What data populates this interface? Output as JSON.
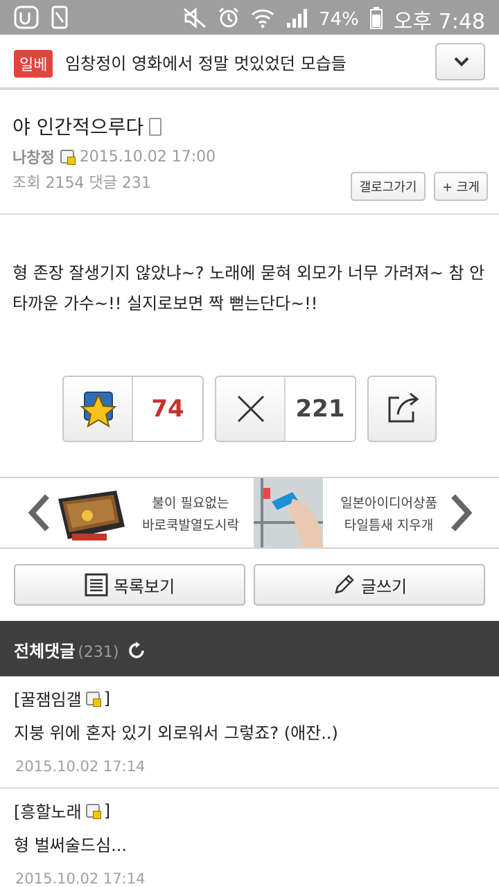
{
  "status_bar": {
    "battery": "74%",
    "time": "오후 7:48"
  },
  "header": {
    "badge": "일베",
    "title": "임창정이 영화에서 정말 멋있었던 모습들"
  },
  "post": {
    "title": "야 인간적으루다",
    "author": "나창정",
    "date": "2015.10.02 17:00",
    "stats": "조회 2154 댓글 231",
    "gallery_btn": "갤로그가기",
    "bigger_btn": "+ 크게",
    "body": "형 존장 잘생기지 않았냐~? 노래에 묻혀 외모가 너무 가려져~ 참 안타까운 가수~!! 실지로보면 짝 뻗는단다~!!"
  },
  "votes": {
    "up_count": "74",
    "down_count": "221"
  },
  "ads": [
    {
      "line1": "불이 필요없는",
      "line2": "바로쿡발열도시락"
    },
    {
      "line1": "일본아이디어상품",
      "line2": "타일틈새 지우개"
    }
  ],
  "actions": {
    "list": "목록보기",
    "write": "글쓰기"
  },
  "comments_header": {
    "title": "전체댓글",
    "count": "(231)"
  },
  "comments": [
    {
      "author": "[꿀잼임갤",
      "close": "]",
      "text": "지붕 위에 혼자 있기 외로워서 그렇죠? (애잔..)",
      "date": "2015.10.02 17:14"
    },
    {
      "author": "[흥할노래",
      "close": "]",
      "text": "형 벌써술드심...",
      "date": "2015.10.02 17:14"
    }
  ],
  "colors": {
    "badge": "#e0463e",
    "up_count": "#c8302f",
    "comments_header_bg": "#3e3e3e",
    "status_bar_bg": "#9e9e9e"
  }
}
